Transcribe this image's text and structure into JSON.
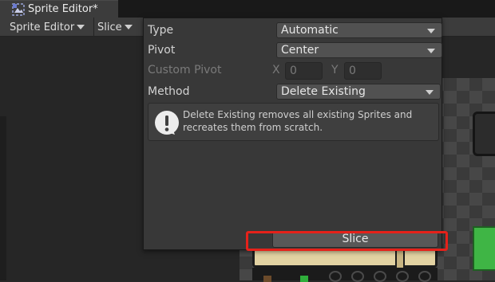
{
  "window": {
    "tab_title": "Sprite Editor*",
    "tab_icon": "sprite-editor-icon"
  },
  "toolbar": {
    "sprite_editor_menu": "Sprite Editor",
    "slice_menu": "Slice"
  },
  "slice_popup": {
    "type": {
      "label": "Type",
      "value": "Automatic"
    },
    "pivot": {
      "label": "Pivot",
      "value": "Center"
    },
    "custom_pivot": {
      "label": "Custom Pivot",
      "x_label": "X",
      "x_value": "0",
      "y_label": "Y",
      "y_value": "0"
    },
    "method": {
      "label": "Method",
      "value": "Delete Existing"
    },
    "help_icon": "info-icon",
    "help_text": "Delete Existing removes all existing Sprites and recreates them from scratch.",
    "slice_button": "Slice"
  },
  "highlight_color": "#e5211a"
}
